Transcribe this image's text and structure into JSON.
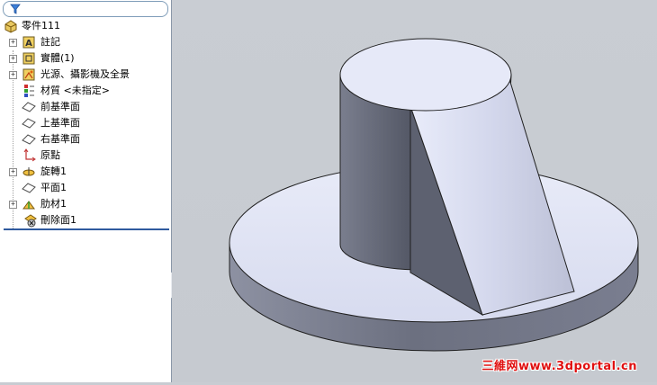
{
  "feature_tree": {
    "root": "零件111",
    "items": [
      {
        "label": "註記",
        "expandable": true,
        "icon": "annotation-icon"
      },
      {
        "label": "實體(1)",
        "expandable": true,
        "icon": "solid-body-icon"
      },
      {
        "label": "光源、攝影機及全景",
        "expandable": true,
        "icon": "lights-camera-scene-icon"
      },
      {
        "label": "材質 <未指定>",
        "expandable": false,
        "icon": "material-icon"
      },
      {
        "label": "前基準面",
        "expandable": false,
        "icon": "plane-icon"
      },
      {
        "label": "上基準面",
        "expandable": false,
        "icon": "plane-icon"
      },
      {
        "label": "右基準面",
        "expandable": false,
        "icon": "plane-icon"
      },
      {
        "label": "原點",
        "expandable": false,
        "icon": "origin-icon"
      },
      {
        "label": "旋轉1",
        "expandable": true,
        "icon": "revolve-icon"
      },
      {
        "label": "平面1",
        "expandable": false,
        "icon": "plane-icon"
      },
      {
        "label": "肋材1",
        "expandable": true,
        "icon": "rib-icon"
      },
      {
        "label": "刪除面1",
        "expandable": false,
        "icon": "delete-face-icon"
      }
    ]
  },
  "watermark": "三維网www.3dportal.cn",
  "colors": {
    "viewport_bg": "#c8ccd2",
    "model_face_light": "#dfe3f5",
    "model_face_dark": "#5d6170",
    "rollback_bar": "#2f5a9e",
    "watermark": "#e01010"
  }
}
